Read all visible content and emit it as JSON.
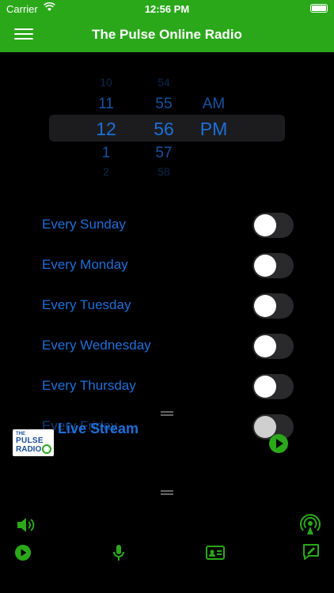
{
  "status_bar": {
    "carrier": "Carrier",
    "time": "12:56 PM"
  },
  "navbar": {
    "title": "The Pulse Online Radio"
  },
  "time_picker": {
    "hours": [
      "10",
      "11",
      "12",
      "1",
      "2"
    ],
    "minutes": [
      "54",
      "55",
      "56",
      "57",
      "58"
    ],
    "ampm": [
      "AM",
      "PM"
    ],
    "selected": {
      "hour": "12",
      "minute": "56",
      "ampm": "PM"
    }
  },
  "schedule": {
    "days": [
      {
        "label": "Every Sunday",
        "on": false
      },
      {
        "label": "Every Monday",
        "on": false
      },
      {
        "label": "Every Tuesday",
        "on": false
      },
      {
        "label": "Every Wednesday",
        "on": false
      },
      {
        "label": "Every Thursday",
        "on": false
      },
      {
        "label": "Every Friday",
        "on": false
      }
    ]
  },
  "player": {
    "title": "Live Stream",
    "logo": {
      "line1": "THE",
      "line2": "PULSE",
      "line3": "RADIO"
    }
  },
  "colors": {
    "accent": "#2aa81a",
    "text_blue": "#1e6fd9",
    "background": "#000000"
  },
  "bottom_icons": [
    "volume-icon",
    "broadcast-icon",
    "play-icon",
    "microphone-icon",
    "contact-card-icon",
    "compose-message-icon"
  ]
}
